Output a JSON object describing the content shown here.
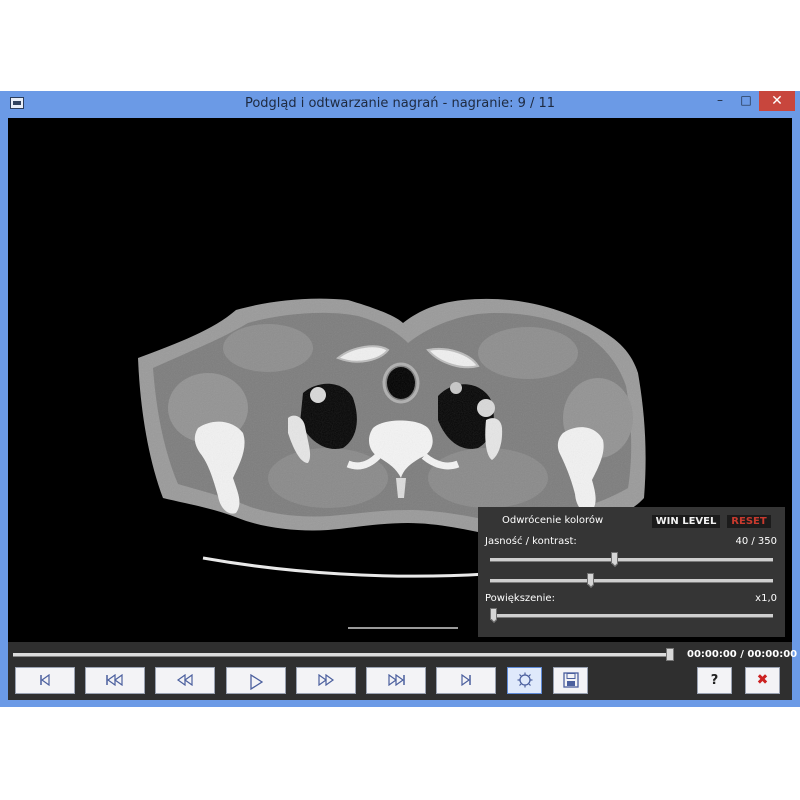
{
  "window": {
    "title": "Podgląd i odtwarzanie nagrań - nagranie: 9 / 11",
    "minimize_glyph": "–",
    "maximize_glyph": "□",
    "close_glyph": "✕"
  },
  "panel": {
    "invert_label": "Odwrócenie kolorów",
    "win_level_label": "WIN LEVEL",
    "reset_label": "RESET",
    "brightness_contrast_label": "Jasność / kontrast:",
    "brightness_contrast_value": "40 / 350",
    "zoom_label": "Powiększenie:",
    "zoom_value": "x1,0",
    "brightness_slider_fraction": 0.44,
    "contrast_slider_fraction": 0.35,
    "zoom_slider_fraction": 0.0
  },
  "playback": {
    "time_readout": "00:00:00 / 00:00:00",
    "seek_fraction": 1.0
  },
  "controls": {
    "help_label": "?",
    "exit_label": "✖"
  },
  "icons": [
    "app-icon",
    "first-frame-icon",
    "skip-back-icon",
    "rewind-icon",
    "play-icon",
    "fast-forward-icon",
    "skip-forward-icon",
    "last-frame-icon",
    "window-level-icon",
    "save-icon",
    "help-icon",
    "exit-icon"
  ],
  "colors": {
    "title_bar": "#6b9ae6",
    "close_button": "#c8463d",
    "panel_bg": "#353535",
    "reset_text": "#c83a2e"
  }
}
